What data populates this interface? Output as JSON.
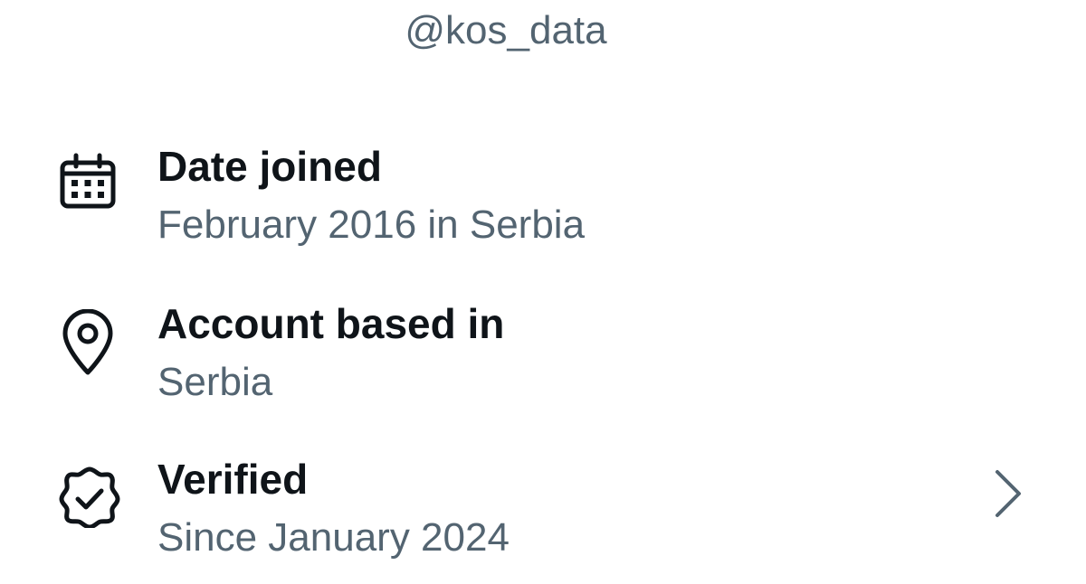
{
  "profile": {
    "handle": "@kos_data"
  },
  "about": {
    "items": [
      {
        "icon": "calendar-icon",
        "title": "Date joined",
        "subtitle": "February 2016 in Serbia"
      },
      {
        "icon": "location-pin-icon",
        "title": "Account based in",
        "subtitle": "Serbia"
      },
      {
        "icon": "verified-badge-icon",
        "title": "Verified",
        "subtitle": "Since January 2024",
        "trailing_icon": "chevron-right-icon"
      }
    ]
  },
  "colors": {
    "primary_text": "#0f1419",
    "secondary_text": "#536471",
    "background": "#ffffff"
  }
}
